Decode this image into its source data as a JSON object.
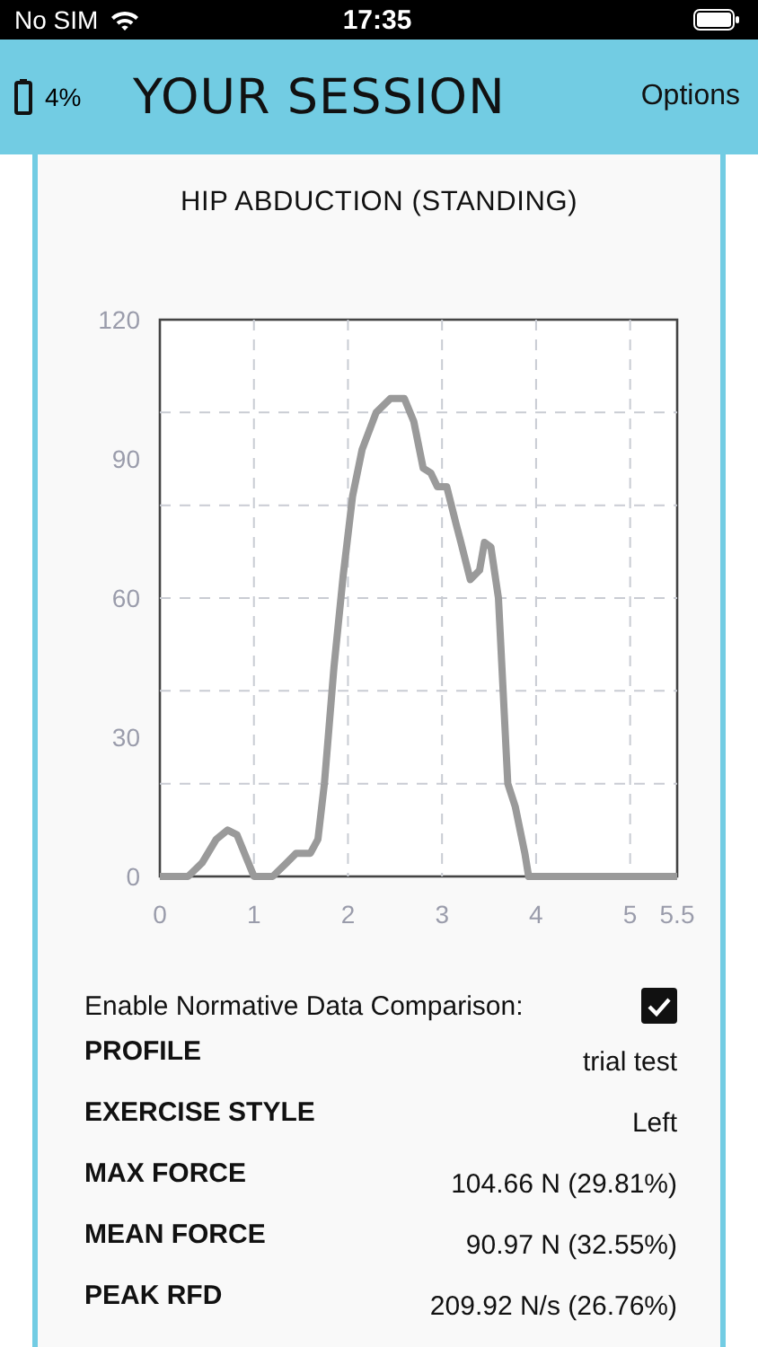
{
  "status_bar": {
    "carrier": "No SIM",
    "time": "17:35"
  },
  "header": {
    "battery": "4%",
    "title": "YOUR SESSION",
    "options": "Options"
  },
  "card": {
    "title": "HIP ABDUCTION (STANDING)",
    "chart_data": {
      "type": "line",
      "xlim": [
        0,
        5.5
      ],
      "ylim": [
        0,
        120
      ],
      "xticks": [
        0,
        1,
        2,
        3,
        4,
        5,
        5.5
      ],
      "yticks": [
        0,
        30,
        60,
        90,
        120
      ],
      "x": [
        0,
        0.3,
        0.45,
        0.6,
        0.72,
        0.82,
        0.92,
        1.0,
        1.2,
        1.35,
        1.45,
        1.6,
        1.68,
        1.75,
        1.85,
        1.95,
        2.05,
        2.15,
        2.3,
        2.45,
        2.6,
        2.7,
        2.8,
        2.88,
        2.95,
        3.05,
        3.15,
        3.2,
        3.3,
        3.4,
        3.45,
        3.52,
        3.6,
        3.7,
        3.78,
        3.88,
        3.92,
        4.5,
        5.5
      ],
      "grid": true,
      "series": [
        {
          "color": "#9a9a9a",
          "values": [
            0,
            0,
            3,
            8,
            10,
            9,
            4,
            0,
            0,
            3,
            5,
            5,
            8,
            20,
            45,
            65,
            82,
            92,
            100,
            103,
            103,
            98,
            88,
            87,
            84,
            84,
            76,
            72,
            64,
            66,
            72,
            71,
            60,
            20,
            15,
            5,
            0,
            0,
            0
          ]
        }
      ]
    },
    "normative": {
      "label": "Enable Normative Data Comparison:",
      "checked": true
    },
    "stats": [
      {
        "label": "PROFILE",
        "value": "trial test"
      },
      {
        "label": "EXERCISE STYLE",
        "value": "Left"
      },
      {
        "label": "MAX FORCE",
        "value": "104.66 N (29.81%)"
      },
      {
        "label": "MEAN FORCE",
        "value": "90.97 N (32.55%)"
      },
      {
        "label": "PEAK RFD",
        "value": "209.92 N/s (26.76%)"
      }
    ]
  }
}
